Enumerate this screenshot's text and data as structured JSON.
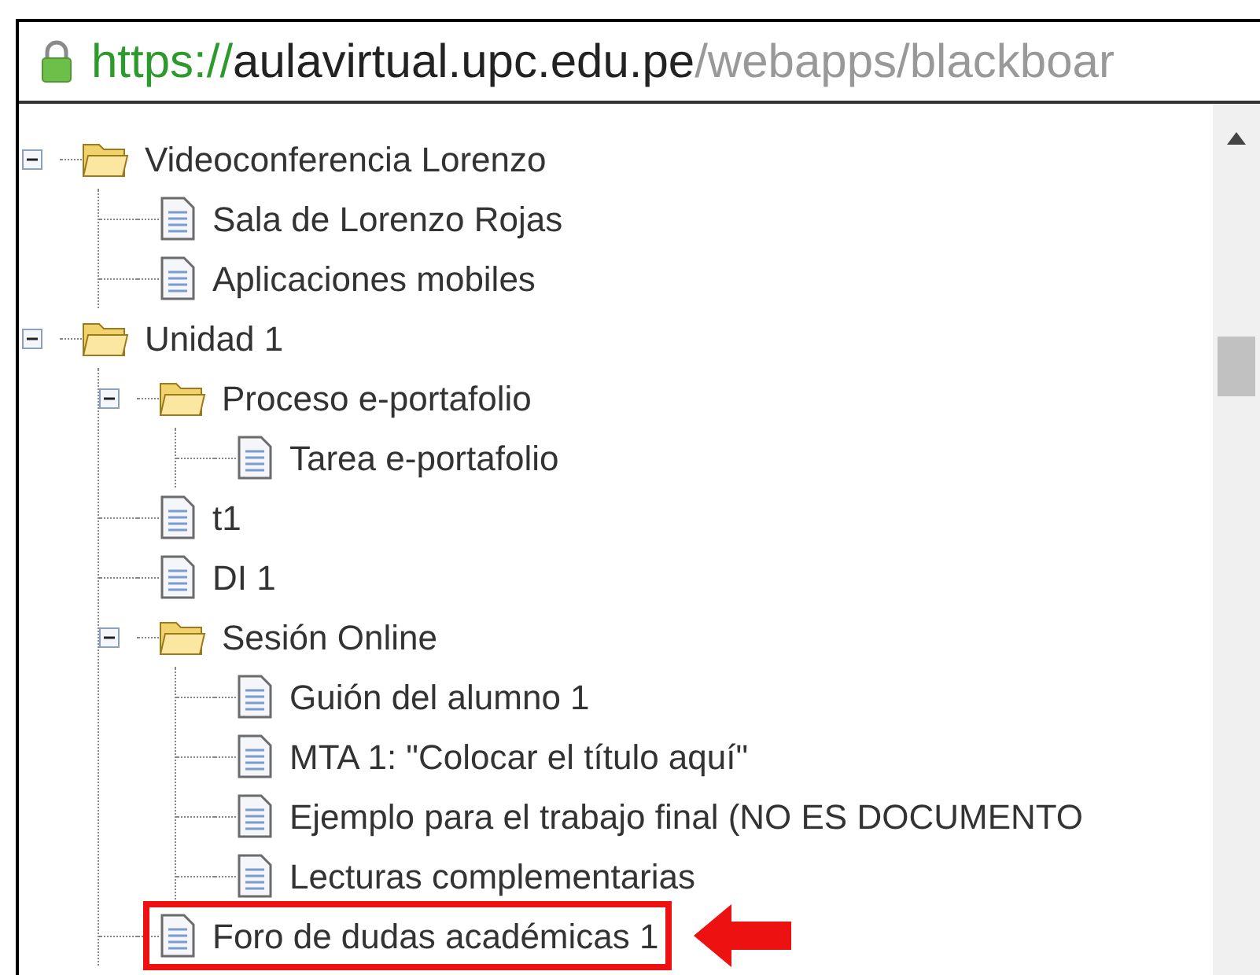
{
  "address_bar": {
    "scheme": "https://",
    "host": "aulavirtual.upc.edu.pe",
    "path": "/webapps/blackboar"
  },
  "tree": [
    {
      "kind": "folder",
      "label": "Videoconferencia Lorenzo",
      "expanded": true,
      "children": [
        {
          "kind": "leaf",
          "label": "Sala de Lorenzo Rojas",
          "highlighted": false
        },
        {
          "kind": "leaf",
          "label": "Aplicaciones mobiles",
          "highlighted": false
        }
      ]
    },
    {
      "kind": "folder",
      "label": "Unidad 1",
      "expanded": true,
      "children": [
        {
          "kind": "folder",
          "label": "Proceso e-portafolio",
          "expanded": true,
          "children": [
            {
              "kind": "leaf",
              "label": "Tarea e-portafolio",
              "highlighted": false
            }
          ]
        },
        {
          "kind": "leaf",
          "label": "t1",
          "highlighted": false
        },
        {
          "kind": "leaf",
          "label": "DI 1",
          "highlighted": false
        },
        {
          "kind": "folder",
          "label": "Sesión Online",
          "expanded": true,
          "children": [
            {
              "kind": "leaf",
              "label": "Guión del alumno 1",
              "highlighted": false
            },
            {
              "kind": "leaf",
              "label": "MTA 1: \"Colocar el título aquí\"",
              "highlighted": false
            },
            {
              "kind": "leaf",
              "label": "Ejemplo para el trabajo final (NO ES DOCUMENTO",
              "highlighted": false
            },
            {
              "kind": "leaf",
              "label": "Lecturas complementarias",
              "highlighted": false
            }
          ]
        },
        {
          "kind": "leaf",
          "label": "Foro de dudas académicas 1",
          "highlighted": true
        }
      ]
    }
  ]
}
